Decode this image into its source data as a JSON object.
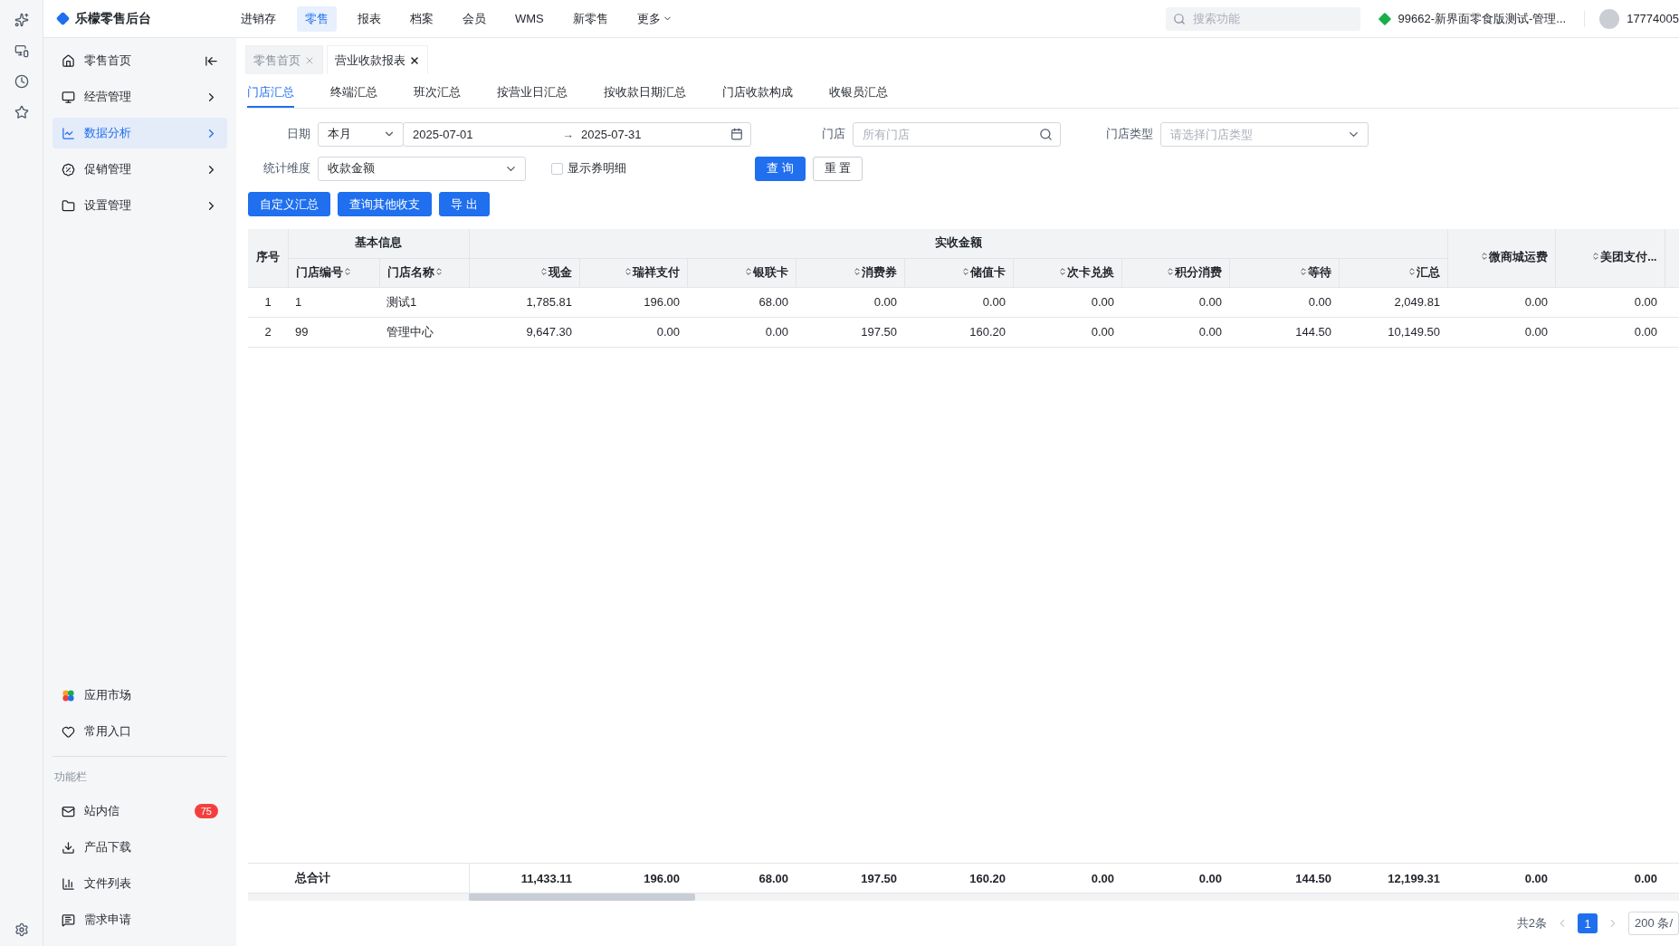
{
  "topbar": {
    "logo": "乐檬零售后台",
    "nav": [
      {
        "label": "进销存",
        "selected": false
      },
      {
        "label": "零售",
        "selected": true
      },
      {
        "label": "报表",
        "selected": false
      },
      {
        "label": "档案",
        "selected": false
      },
      {
        "label": "会员",
        "selected": false
      },
      {
        "label": "WMS",
        "selected": false
      },
      {
        "label": "新零售",
        "selected": false
      },
      {
        "label": "更多",
        "selected": false,
        "dropdown": true
      }
    ],
    "search": {
      "placeholder": "搜索功能"
    },
    "store": "99662-新界面零食版测试-管理...",
    "user": "17774005"
  },
  "sidebar": {
    "items": [
      {
        "label": "零售首页",
        "kind": "home",
        "selected": false
      },
      {
        "label": "经营管理",
        "kind": "group",
        "selected": false
      },
      {
        "label": "数据分析",
        "kind": "group",
        "selected": true
      },
      {
        "label": "促销管理",
        "kind": "group",
        "selected": false
      },
      {
        "label": "设置管理",
        "kind": "group",
        "selected": false
      }
    ],
    "bottom": [
      {
        "label": "应用市场"
      },
      {
        "label": "常用入口"
      }
    ],
    "section_title": "功能栏",
    "tools": [
      {
        "label": "站内信",
        "badge": "75"
      },
      {
        "label": "产品下载"
      },
      {
        "label": "文件列表"
      },
      {
        "label": "需求申请"
      }
    ]
  },
  "page_tabs": [
    {
      "label": "零售首页",
      "selected": false
    },
    {
      "label": "营业收款报表",
      "selected": true
    }
  ],
  "sub_tabs": [
    {
      "label": "门店汇总",
      "selected": true
    },
    {
      "label": "终端汇总",
      "selected": false
    },
    {
      "label": "班次汇总",
      "selected": false
    },
    {
      "label": "按营业日汇总",
      "selected": false
    },
    {
      "label": "按收款日期汇总",
      "selected": false
    },
    {
      "label": "门店收款构成",
      "selected": false
    },
    {
      "label": "收银员汇总",
      "selected": false
    }
  ],
  "filters": {
    "date_label": "日期",
    "period": "本月",
    "start": "2025-07-01",
    "range_separator": "→",
    "end": "2025-07-31",
    "store_label": "门店",
    "store_placeholder": "所有门店",
    "type_label": "门店类型",
    "type_placeholder": "请选择门店类型",
    "dimension_label": "统计维度",
    "dimension": "收款金额",
    "coupon_detail": {
      "label": "显示券明细",
      "checked": false
    },
    "query": "查 询",
    "reset": "重 置"
  },
  "actions": [
    "自定义汇总",
    "查询其他收支",
    "导 出"
  ],
  "table": {
    "group_basic": "基本信息",
    "group_amount": "实收金额",
    "columns": [
      "序号",
      "门店编号",
      "门店名称",
      "现金",
      "瑞祥支付",
      "银联卡",
      "消费券",
      "储值卡",
      "次卡兑换",
      "积分消费",
      "等待",
      "汇总",
      "微商城运费",
      "美团支付..."
    ],
    "rows": [
      [
        "1",
        "1",
        "测试1",
        "1,785.81",
        "196.00",
        "68.00",
        "0.00",
        "0.00",
        "0.00",
        "0.00",
        "0.00",
        "2,049.81",
        "0.00",
        "0.00"
      ],
      [
        "2",
        "99",
        "管理中心",
        "9,647.30",
        "0.00",
        "0.00",
        "197.50",
        "160.20",
        "0.00",
        "0.00",
        "144.50",
        "10,149.50",
        "0.00",
        "0.00"
      ]
    ],
    "total_label": "总合计",
    "totals": [
      "11,433.11",
      "196.00",
      "68.00",
      "197.50",
      "160.20",
      "0.00",
      "0.00",
      "144.50",
      "12,199.31",
      "0.00",
      "0.00"
    ]
  },
  "pagination": {
    "total": "共2条",
    "pages": [
      {
        "label": "1",
        "selected": true
      }
    ],
    "page_size": "200 条/"
  }
}
